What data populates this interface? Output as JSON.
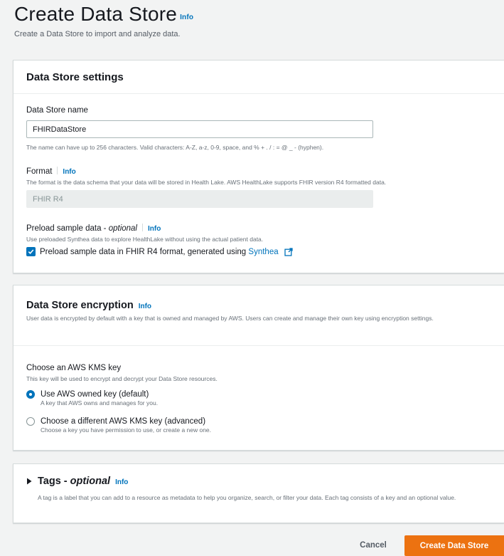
{
  "page": {
    "title": "Create Data Store",
    "info": "Info",
    "subtitle": "Create a Data Store to import and analyze data."
  },
  "settings": {
    "header": "Data Store settings",
    "name_label": "Data Store name",
    "name_value": "FHIRDataStore",
    "name_hint": "The name can have up to 256 characters. Valid characters: A-Z, a-z, 0-9, space, and % + . / : = @ _ - (hyphen).",
    "format_label": "Format",
    "format_info": "Info",
    "format_desc": "The format is the data schema that your data will be stored in Health Lake. AWS HealthLake supports FHIR version R4 formatted data.",
    "format_value": "FHIR R4",
    "preload_label": "Preload sample data - ",
    "preload_optional": "optional",
    "preload_info": "Info",
    "preload_desc": "Use preloaded Synthea data to explore HealthLake without using the actual patient data.",
    "preload_checkbox_label": "Preload sample data in FHIR R4 format, generated using ",
    "preload_link": "Synthea",
    "preload_checked": true
  },
  "encryption": {
    "header": "Data Store encryption",
    "info": "Info",
    "desc": "User data is encrypted by default with a key that is owned and managed by AWS. Users can create and manage their own key using encryption settings.",
    "kms_label": "Choose an AWS KMS key",
    "kms_desc": "This key will be used to encrypt and decrypt your Data Store resources.",
    "options": [
      {
        "title": "Use AWS owned key (default)",
        "desc": "A key that AWS owns and manages for you.",
        "selected": true
      },
      {
        "title": "Choose a different AWS KMS key (advanced)",
        "desc": "Choose a key you have permission to use, or create a new one.",
        "selected": false
      }
    ]
  },
  "tags": {
    "header": "Tags - ",
    "optional": "optional",
    "info": "Info",
    "desc": "A tag is a label that you can add to a resource as metadata to help you organize, search, or filter your data. Each tag consists of a key and an optional value."
  },
  "footer": {
    "cancel": "Cancel",
    "submit": "Create Data Store"
  },
  "colors": {
    "primary": "#ec7211",
    "link": "#0073bb",
    "background": "#f2f3f3"
  },
  "icons": [
    "external-link-icon",
    "checkmark-icon",
    "caret-right-icon"
  ]
}
